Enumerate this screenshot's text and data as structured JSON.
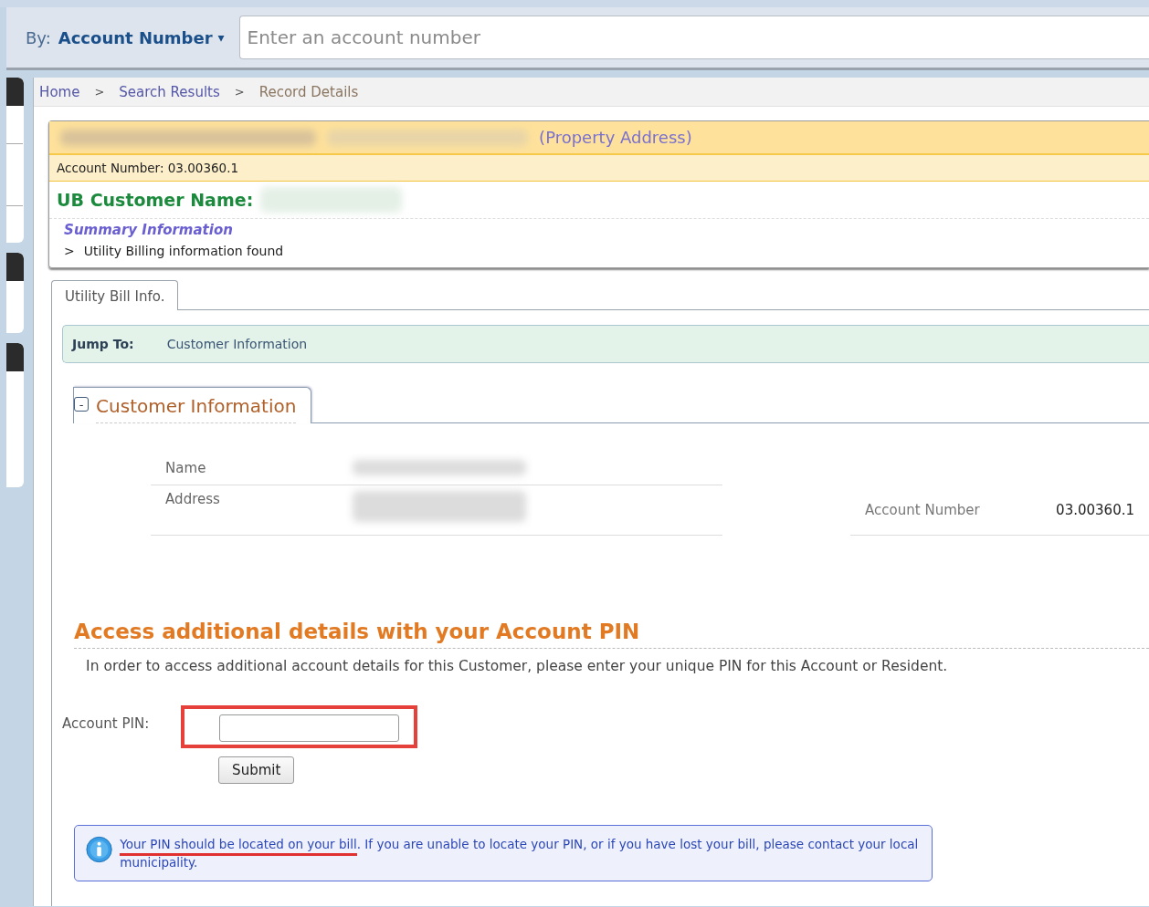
{
  "search": {
    "by_label": "By:",
    "by_value": "Account Number",
    "caret": "▾",
    "placeholder": "Enter an account number"
  },
  "breadcrumb": {
    "items": [
      {
        "label": "Home",
        "kind": "link"
      },
      {
        "label": "Search Results",
        "kind": "link"
      },
      {
        "label": "Record Details",
        "kind": "current"
      }
    ],
    "separators": [
      ">",
      ">"
    ]
  },
  "record": {
    "property_label": "(Property Address)",
    "account_line": "Account Number: 03.00360.1",
    "customer_name_label": "UB Customer Name:",
    "summary_title": "Summary Information",
    "summary_items": [
      {
        "marker": ">",
        "text": "Utility Billing information found"
      }
    ]
  },
  "tabs": [
    {
      "label": "Utility Bill Info.",
      "selected": true
    }
  ],
  "jump": {
    "label": "Jump To:",
    "links": [
      "Customer Information"
    ]
  },
  "section": {
    "title": "Customer Information",
    "toggle": "-",
    "details_left": [
      {
        "label": "Name"
      },
      {
        "label": "Address"
      }
    ],
    "details_right": [
      {
        "label": "Account Number",
        "value": "03.00360.1"
      }
    ]
  },
  "pin": {
    "heading": "Access additional details with your Account PIN",
    "intro": "In order to access additional account details for this Customer, please enter your unique PIN for this Account or Resident.",
    "label": "Account PIN:",
    "submit": "Submit",
    "highlighted": true
  },
  "info": {
    "link": "Your PIN should be located on your bill",
    "text": ". If you are unable to locate your PIN, or if you have lost your bill, please contact your local municipality.",
    "underlined": true
  }
}
